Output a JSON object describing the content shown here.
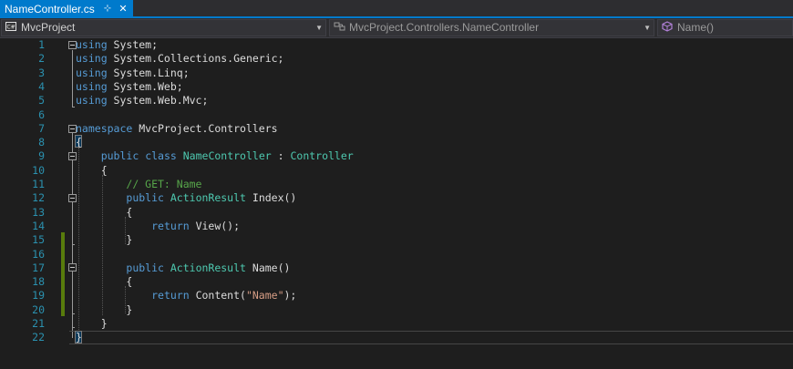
{
  "tab": {
    "title": "NameController.cs",
    "pin_glyph": "⊹",
    "close_glyph": "✕"
  },
  "navbar": {
    "project": {
      "icon": "csharp-project-icon",
      "label": "MvcProject"
    },
    "class": {
      "icon": "class-icon",
      "label": "MvcProject.Controllers.NameController"
    },
    "member": {
      "icon": "method-icon",
      "label": "Name()"
    }
  },
  "colors": {
    "keyword": "#569cd6",
    "type": "#4ec9b0",
    "comment": "#57a64a",
    "string": "#d69d85",
    "line_number": "#2b91af",
    "accent": "#007acc",
    "change_bar": "#587c0c"
  },
  "editor": {
    "active_line": 22,
    "changed_lines": [
      15,
      16,
      17,
      18,
      19,
      20
    ],
    "lines": [
      {
        "n": "1",
        "indent": "",
        "tokens": [
          {
            "t": "using",
            "c": "kw"
          },
          {
            "t": " System;",
            "c": "pl"
          }
        ]
      },
      {
        "n": "2",
        "indent": "",
        "tokens": [
          {
            "t": "using",
            "c": "kw"
          },
          {
            "t": " System.Collections.Generic;",
            "c": "pl"
          }
        ]
      },
      {
        "n": "3",
        "indent": "",
        "tokens": [
          {
            "t": "using",
            "c": "kw"
          },
          {
            "t": " System.Linq;",
            "c": "pl"
          }
        ]
      },
      {
        "n": "4",
        "indent": "",
        "tokens": [
          {
            "t": "using",
            "c": "kw"
          },
          {
            "t": " System.Web;",
            "c": "pl"
          }
        ]
      },
      {
        "n": "5",
        "indent": "",
        "tokens": [
          {
            "t": "using",
            "c": "kw"
          },
          {
            "t": " System.Web.Mvc;",
            "c": "pl"
          }
        ]
      },
      {
        "n": "6",
        "indent": "",
        "tokens": []
      },
      {
        "n": "7",
        "indent": "",
        "tokens": [
          {
            "t": "namespace",
            "c": "kw"
          },
          {
            "t": " MvcProject.Controllers",
            "c": "pl"
          }
        ]
      },
      {
        "n": "8",
        "indent": "",
        "tokens": [
          {
            "t": "{",
            "c": "pl"
          }
        ]
      },
      {
        "n": "9",
        "indent": "    ",
        "tokens": [
          {
            "t": "public",
            "c": "kw"
          },
          {
            "t": " ",
            "c": "pl"
          },
          {
            "t": "class",
            "c": "kw"
          },
          {
            "t": " ",
            "c": "pl"
          },
          {
            "t": "NameController",
            "c": "ty"
          },
          {
            "t": " : ",
            "c": "pl"
          },
          {
            "t": "Controller",
            "c": "ty"
          }
        ]
      },
      {
        "n": "10",
        "indent": "    ",
        "tokens": [
          {
            "t": "{",
            "c": "pl"
          }
        ]
      },
      {
        "n": "11",
        "indent": "        ",
        "tokens": [
          {
            "t": "// GET: Name",
            "c": "cm"
          }
        ]
      },
      {
        "n": "12",
        "indent": "        ",
        "tokens": [
          {
            "t": "public",
            "c": "kw"
          },
          {
            "t": " ",
            "c": "pl"
          },
          {
            "t": "ActionResult",
            "c": "ty"
          },
          {
            "t": " Index()",
            "c": "pl"
          }
        ]
      },
      {
        "n": "13",
        "indent": "        ",
        "tokens": [
          {
            "t": "{",
            "c": "pl"
          }
        ]
      },
      {
        "n": "14",
        "indent": "            ",
        "tokens": [
          {
            "t": "return",
            "c": "kw"
          },
          {
            "t": " View();",
            "c": "pl"
          }
        ]
      },
      {
        "n": "15",
        "indent": "        ",
        "tokens": [
          {
            "t": "}",
            "c": "pl"
          }
        ]
      },
      {
        "n": "16",
        "indent": "",
        "tokens": []
      },
      {
        "n": "17",
        "indent": "        ",
        "tokens": [
          {
            "t": "public",
            "c": "kw"
          },
          {
            "t": " ",
            "c": "pl"
          },
          {
            "t": "ActionResult",
            "c": "ty"
          },
          {
            "t": " Name()",
            "c": "pl"
          }
        ]
      },
      {
        "n": "18",
        "indent": "        ",
        "tokens": [
          {
            "t": "{",
            "c": "pl"
          }
        ]
      },
      {
        "n": "19",
        "indent": "            ",
        "tokens": [
          {
            "t": "return",
            "c": "kw"
          },
          {
            "t": " Content(",
            "c": "pl"
          },
          {
            "t": "\"Name\"",
            "c": "st"
          },
          {
            "t": ");",
            "c": "pl"
          }
        ]
      },
      {
        "n": "20",
        "indent": "        ",
        "tokens": [
          {
            "t": "}",
            "c": "pl"
          }
        ]
      },
      {
        "n": "21",
        "indent": "    ",
        "tokens": [
          {
            "t": "}",
            "c": "pl"
          }
        ]
      },
      {
        "n": "22",
        "indent": "",
        "tokens": [
          {
            "t": "}",
            "c": "pl"
          }
        ]
      }
    ]
  }
}
